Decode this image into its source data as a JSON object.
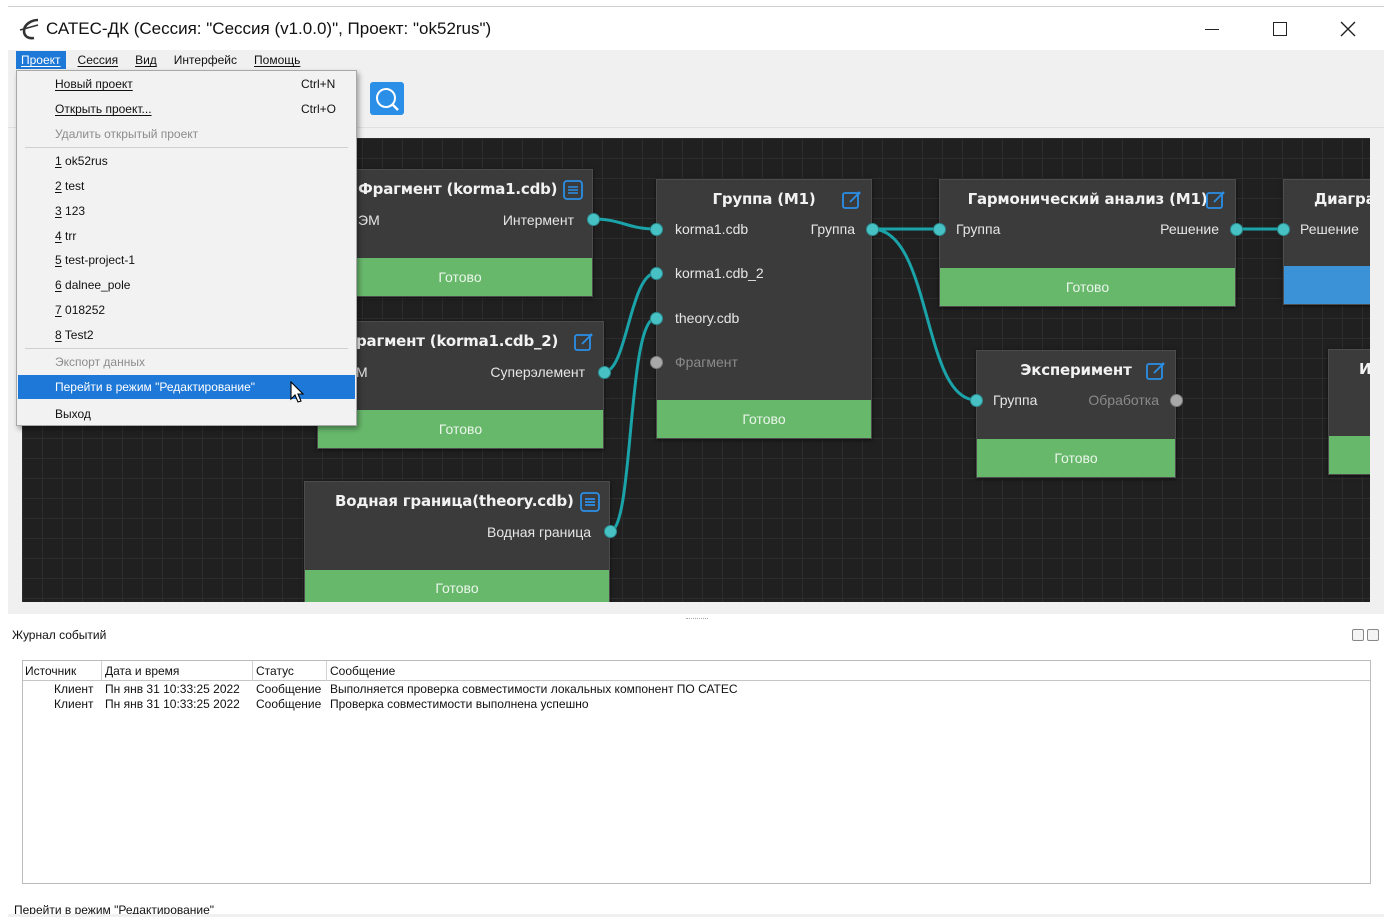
{
  "window": {
    "title": "САТЕС-ДК (Сессия: \"Сессия (v1.0.0)\", Проект: \"ok52rus\")"
  },
  "menubar": {
    "items": [
      "Проект",
      "Сессия",
      "Вид",
      "Интерфейс",
      "Помощь"
    ]
  },
  "project_menu": {
    "new_project": "Новый проект",
    "new_project_shortcut": "Ctrl+N",
    "open_project": "Открыть проект...",
    "open_project_shortcut": "Ctrl+O",
    "delete_project": "Удалить открытый проект",
    "recent": [
      {
        "num": "1",
        "name": " ok52rus"
      },
      {
        "num": "2",
        "name": " test"
      },
      {
        "num": "3",
        "name": " 123"
      },
      {
        "num": "4",
        "name": " trr"
      },
      {
        "num": "5",
        "name": " test-project-1"
      },
      {
        "num": "6",
        "name": " dalnee_pole"
      },
      {
        "num": "7",
        "name": " 018252"
      },
      {
        "num": "8",
        "name": " Test2"
      }
    ],
    "export_data": "Экспорт данных",
    "edit_mode": "Перейти в режим \"Редактирование\"",
    "exit": "Выход"
  },
  "nodes": {
    "fragment1": {
      "title": "Фрагмент (korma1.cdb)",
      "left_port": "ЭМ",
      "right_port": "Интермент",
      "status": "Готово"
    },
    "fragment2": {
      "title": "рагмент (korma1.cdb_2)",
      "left_port": "М",
      "right_port": "Суперэлемент",
      "status": "Готово"
    },
    "water": {
      "title": "Водная граница(theory.cdb)",
      "right_port": "Водная граница",
      "status": "Готово"
    },
    "group": {
      "title": "Группа (M1)",
      "inputs": [
        "korma1.cdb",
        "korma1.cdb_2",
        "theory.cdb",
        "Фрагмент"
      ],
      "output": "Группа",
      "status": "Готово"
    },
    "harmonic": {
      "title": "Гармонический анализ (M1)",
      "input": "Группа",
      "output": "Решение",
      "status": "Готово"
    },
    "experiment": {
      "title": "Эксперимент",
      "input": "Группа",
      "output": "Обработка",
      "status": "Готово"
    },
    "diagram": {
      "title": "Диагра",
      "input": "Решение"
    },
    "partial": {
      "title": "И"
    }
  },
  "log": {
    "title": "Журнал событий",
    "columns": [
      "Источник",
      "Дата и время",
      "Статус",
      "Сообщение"
    ],
    "rows": [
      {
        "source": "Клиент",
        "datetime": "Пн янв 31 10:33:25 2022",
        "status": "Сообщение",
        "message": "Выполняется проверка совместимости локальных компонент ПО САТЕС"
      },
      {
        "source": "Клиент",
        "datetime": "Пн янв 31 10:33:25 2022",
        "status": "Сообщение",
        "message": "Проверка совместимости выполнена успешно"
      }
    ]
  },
  "statusbar": {
    "text": "Перейти в режим \"Редактирование\""
  },
  "colors": {
    "accent": "#1e78d7",
    "port": "#48c1c4",
    "wire": "#1aa3a8",
    "node_ready": "#68b86c",
    "canvas_bg": "#202020"
  },
  "icons": [
    "app-logo-icon",
    "minimize-icon",
    "maximize-icon",
    "close-icon",
    "search-icon",
    "list-icon",
    "edit-icon",
    "cursor-icon"
  ]
}
